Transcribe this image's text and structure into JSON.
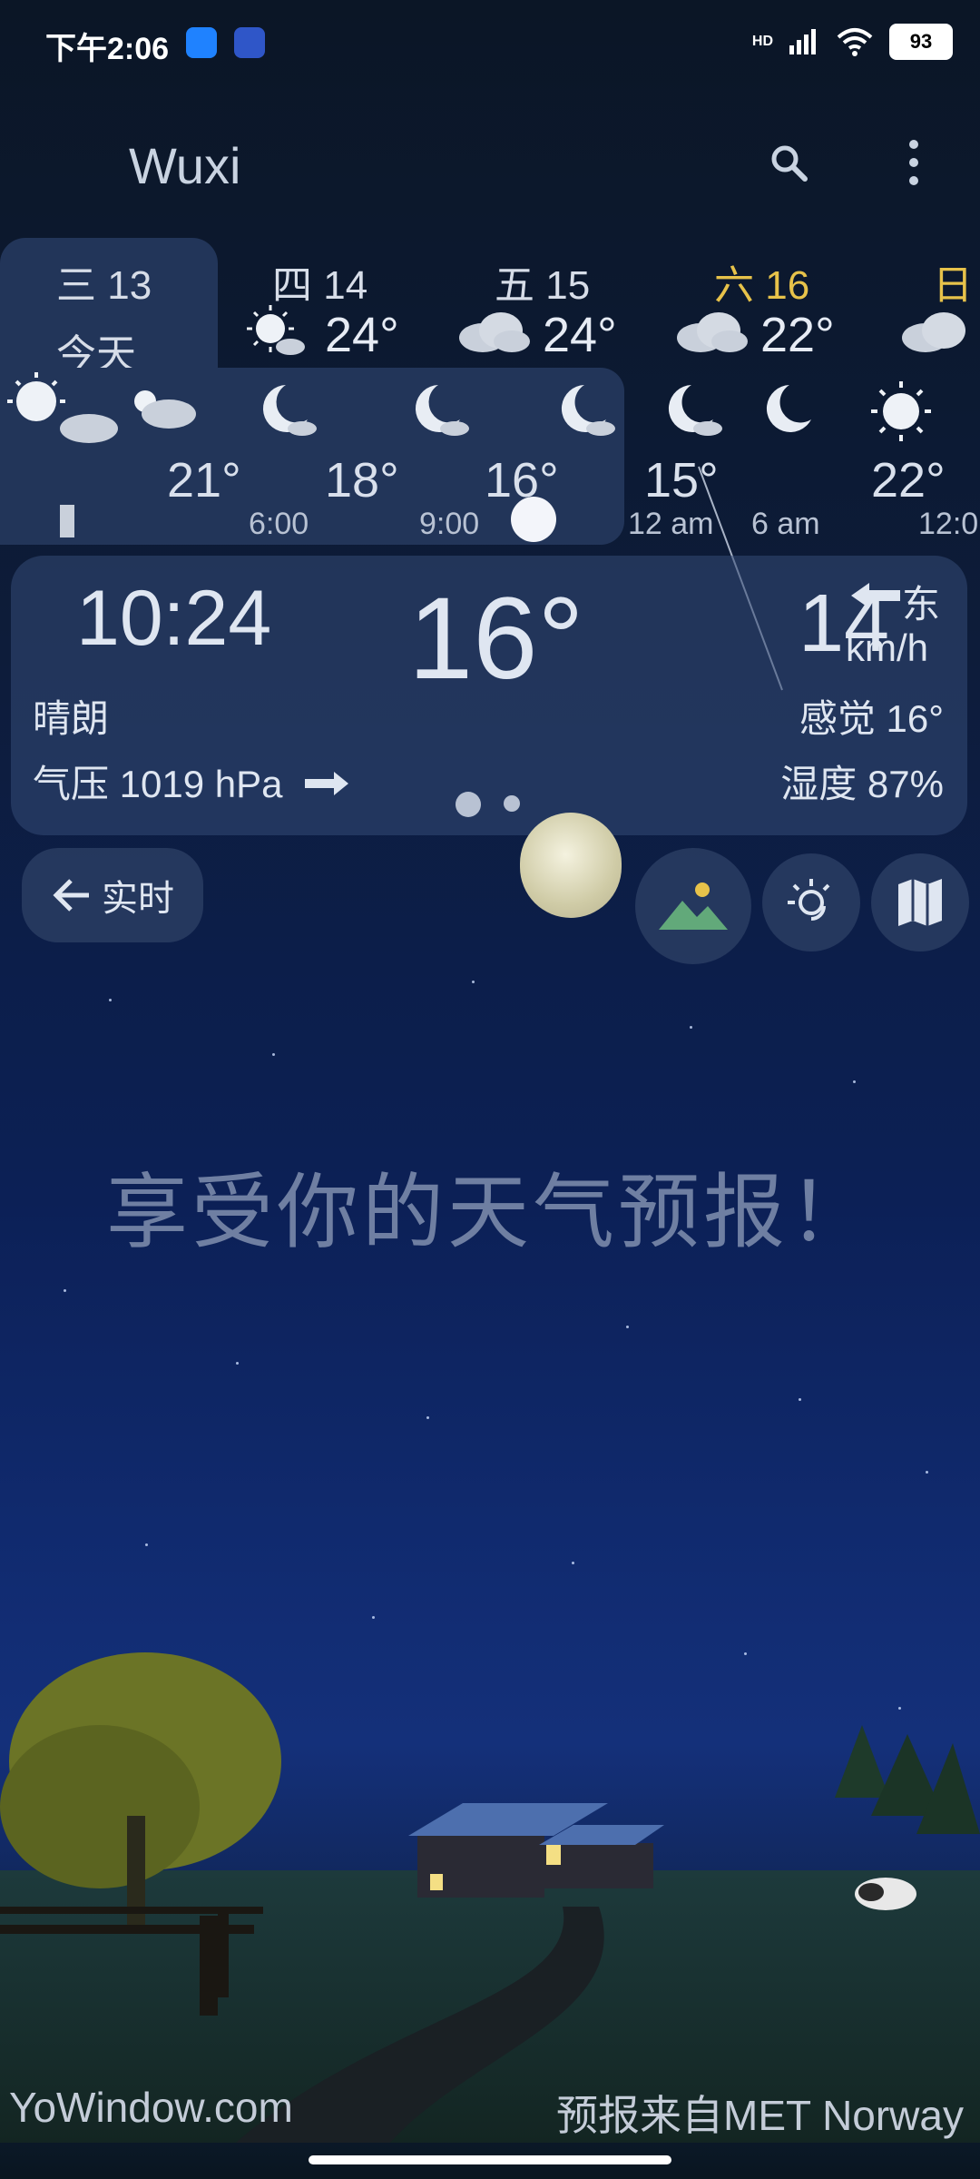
{
  "status_bar": {
    "time": "下午2:06",
    "network": "HD",
    "battery": "93"
  },
  "toolbar": {
    "city": "Wuxi",
    "icons": [
      "search-icon",
      "more-vert-icon"
    ]
  },
  "days": [
    {
      "label": "三 13",
      "sub": "今天",
      "icon": "sun-cloud-icon",
      "temp": ""
    },
    {
      "label": "四 14",
      "icon": "sun-cloud-icon",
      "temp": "24°"
    },
    {
      "label": "五 15",
      "icon": "cloud-icon",
      "temp": "24°"
    },
    {
      "label": "六 16",
      "icon": "cloud-icon",
      "temp": "22°"
    },
    {
      "label": "日",
      "icon": "cloud-icon",
      "temp": ""
    }
  ],
  "hourly": {
    "temps": [
      "21°",
      "18°",
      "16°",
      "15°",
      "22°"
    ],
    "times": [
      "6:00",
      "9:00",
      "12 am",
      "6 am",
      "12:0"
    ]
  },
  "current": {
    "time": "10:24",
    "temp": "16°",
    "wind_speed": "14",
    "wind_dir": "东",
    "wind_unit": "km/h",
    "condition": "晴朗",
    "feels_like": "感觉 16°",
    "pressure": "气压 1019 hPa",
    "humidity": "湿度 87%"
  },
  "buttons": {
    "live": "实时"
  },
  "main": {
    "enjoy": "享受你的天气预报！"
  },
  "footer": {
    "left": "YoWindow.com",
    "right": "预报来自MET Norway"
  },
  "colors": {
    "accent_gold": "#e7c24a",
    "card": "#223559"
  }
}
